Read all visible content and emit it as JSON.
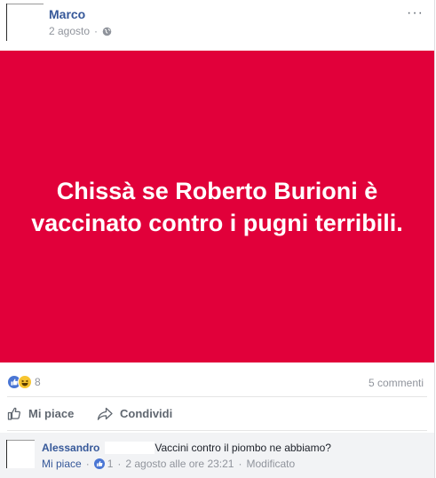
{
  "post": {
    "author": "Marco",
    "date": "2 agosto",
    "dot": "·",
    "more": "···",
    "banner_text": "Chissà se Roberto Burioni è vaccinato contro i pugni terribili.",
    "banner_color": "#e1003a"
  },
  "stats": {
    "reaction_count": "8",
    "comments_count": "5 commenti",
    "reactions": [
      "like-icon",
      "haha-icon"
    ]
  },
  "actions": {
    "like": "Mi piace",
    "share": "Condividi"
  },
  "comment": {
    "author": "Alessandro",
    "text": "Vaccini contro il piombo ne abbiamo?",
    "like": "Mi piace",
    "sep": "·",
    "like_count": "1",
    "timestamp": "2 agosto alle ore 23:21",
    "edited": "Modificato"
  }
}
